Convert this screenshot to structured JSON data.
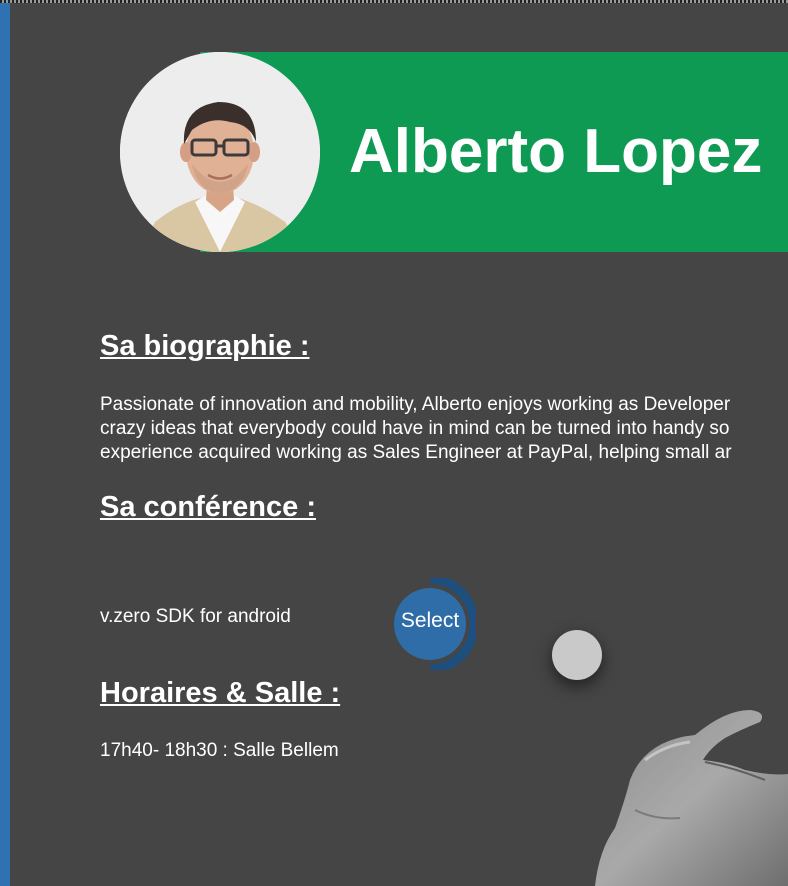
{
  "speaker": {
    "name": "Alberto Lopez",
    "photo_alt": "speaker-photo"
  },
  "bio": {
    "heading": "Sa biographie :",
    "lines": [
      "Passionate of innovation and mobility, Alberto enjoys working as Developer",
      "crazy ideas that everybody could have in mind can be turned into handy so",
      "experience acquired working as Sales Engineer at PayPal, helping small ar"
    ]
  },
  "conference": {
    "heading": "Sa conférence :",
    "title": "v.zero SDK for android",
    "select_label": "Select"
  },
  "schedule": {
    "heading": "Horaires & Salle :",
    "value": "17h40- 18h30 : Salle Bellem"
  },
  "colors": {
    "background": "#454545",
    "accent_green": "#0f9a54",
    "accent_blue": "#2f72b1",
    "select_ring": "#1e4f7e"
  },
  "icons": {
    "cursor": "touch-cursor-icon",
    "hand": "pointing-hand-icon"
  }
}
